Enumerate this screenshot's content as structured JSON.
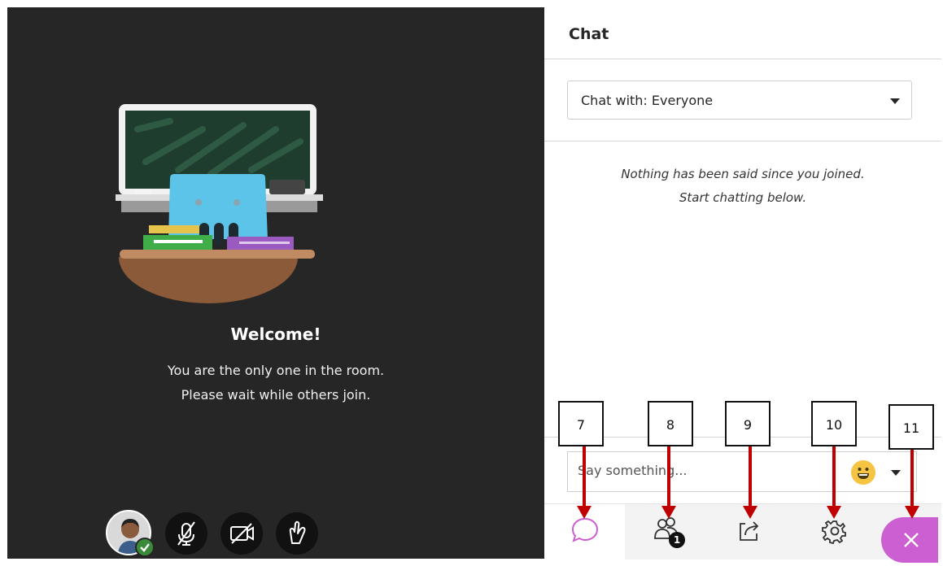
{
  "welcome": {
    "title": "Welcome!",
    "line1": "You are the only one in the room.",
    "line2": "Please wait while others join."
  },
  "media_controls": [
    "avatar",
    "microphone-off-icon",
    "camera-off-icon",
    "hand-raise-icon"
  ],
  "chat": {
    "title": "Chat",
    "chat_with": "Chat with: Everyone",
    "empty_line1": "Nothing has been said since you joined.",
    "empty_line2": "Start chatting below.",
    "placeholder": "Say something..."
  },
  "tabs": [
    {
      "name": "chat",
      "icon": "chat-bubble-icon",
      "active": true
    },
    {
      "name": "attendees",
      "icon": "people-icon",
      "badge": "1"
    },
    {
      "name": "share-content",
      "icon": "share-icon"
    },
    {
      "name": "settings",
      "icon": "gear-icon"
    },
    {
      "name": "close",
      "icon": "close-icon"
    }
  ],
  "callouts": [
    "7",
    "8",
    "9",
    "10",
    "11"
  ],
  "colors": {
    "stage_bg": "#262626",
    "accent": "#cc5fd1",
    "arrow": "#c00000",
    "status_ok": "#3a8a3a"
  }
}
